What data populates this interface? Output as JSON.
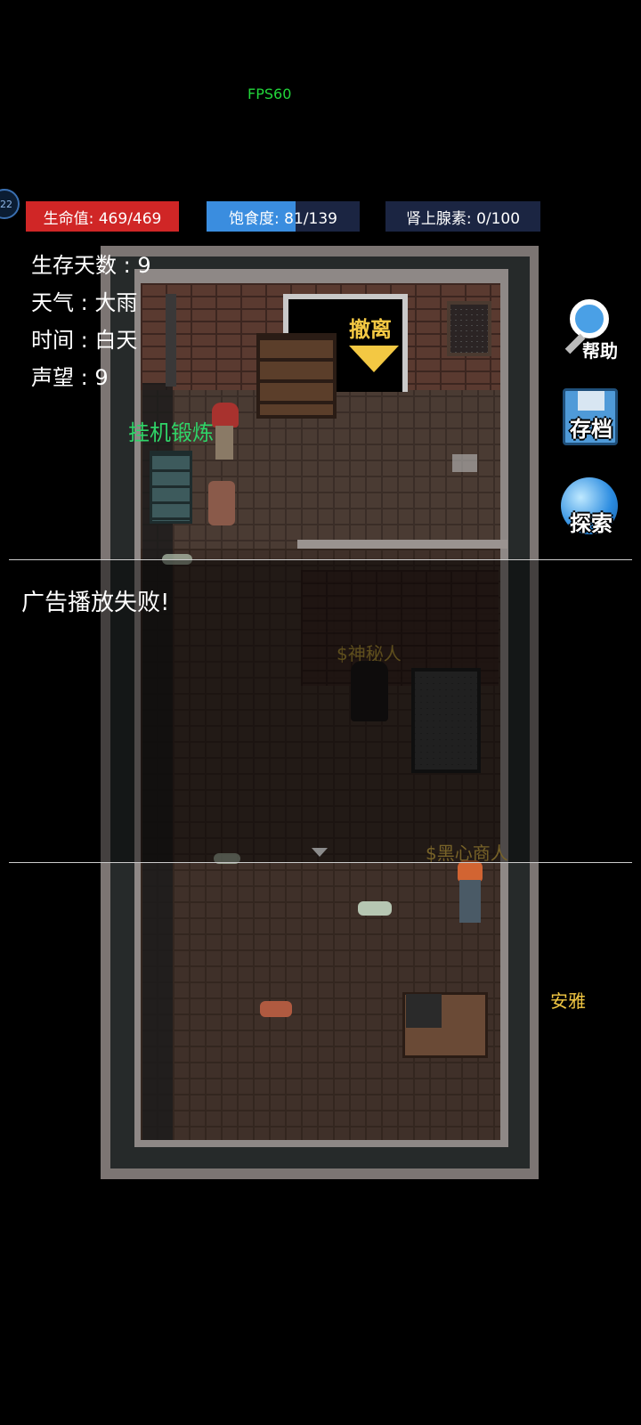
{
  "fps": "FPS60",
  "level_badge": "22",
  "bars": {
    "hp": {
      "label": "生命值: 469/469",
      "color": "#d02626",
      "fraction": 1.0
    },
    "food": {
      "label": "饱食度: 81/139",
      "color": "#3a8ddf",
      "fraction": 0.58
    },
    "adrenaline": {
      "label": "肾上腺素: 0/100",
      "color": "#1b2542",
      "fraction": 0.0
    }
  },
  "stats": {
    "days": "生存天数 : 9",
    "weather": "天气 : 大雨",
    "time": "时间 : 白天",
    "reputation": "声望 : 9"
  },
  "map": {
    "exit_label": "撤离",
    "forge_label": "挂机锻炼",
    "mystic_label": "$神秘人",
    "merchant_label": "$黑心商人"
  },
  "notification": "广告播放失败!",
  "side_buttons": {
    "help": {
      "label": "帮助",
      "icon": "magnifier-icon"
    },
    "save": {
      "label": "存档",
      "icon": "floppy-disk-icon"
    },
    "explore": {
      "label": "探索",
      "icon": "globe-icon"
    }
  },
  "npc_anya": "安雅",
  "colors": {
    "accent_green": "#2fd468",
    "gold": "#f3c843",
    "fps_green": "#22d63a"
  }
}
